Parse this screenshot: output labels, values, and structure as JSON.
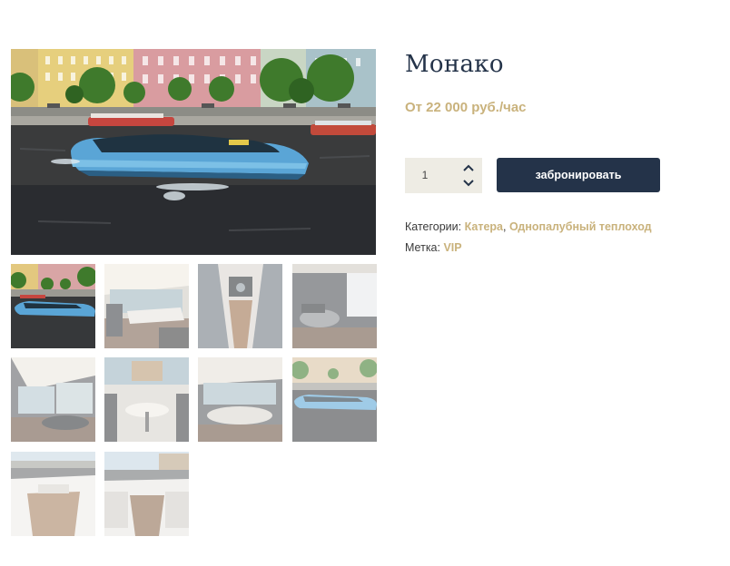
{
  "product": {
    "title": "Монако",
    "price": "От 22 000 руб./час"
  },
  "cart": {
    "quantity": "1",
    "book_label": "забронировать"
  },
  "meta": {
    "categories_label": "Категории:",
    "categories": [
      "Катера",
      "Однопалубный теплоход"
    ],
    "separator": ",",
    "tag_label": "Метка:",
    "tag": "VIP"
  },
  "gallery": {
    "thumbnail_count": 10,
    "active_index": 0
  },
  "colors": {
    "accent": "#c9b27c",
    "primary": "#243349",
    "qty_background": "#eeece4"
  },
  "icons": {
    "qty_up": "chevron-up-icon",
    "qty_down": "chevron-down-icon"
  }
}
